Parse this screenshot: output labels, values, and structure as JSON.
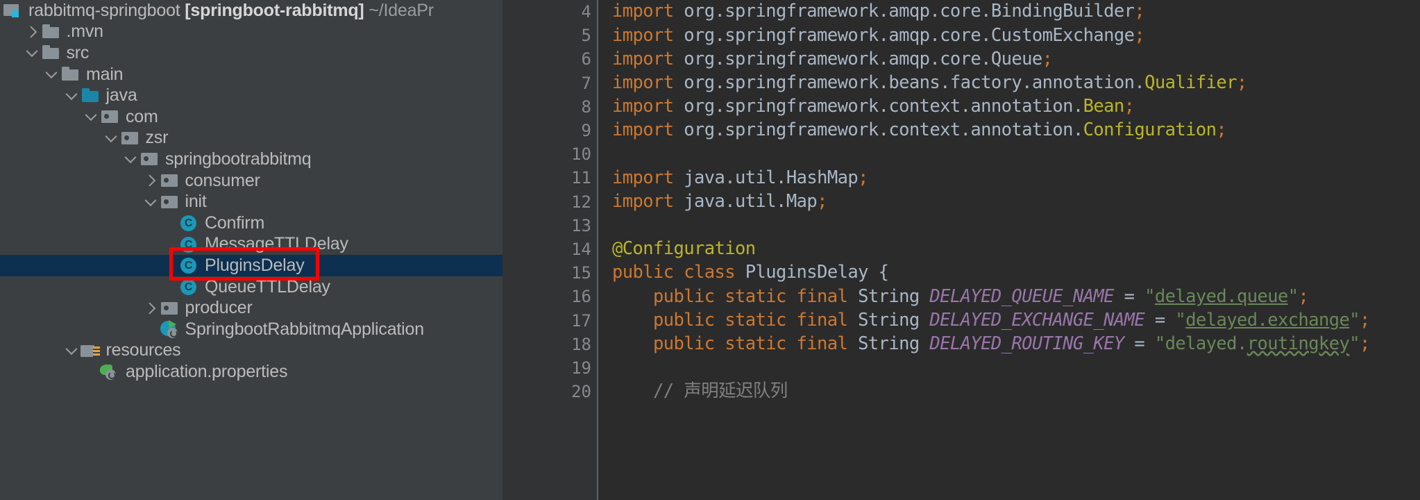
{
  "sidebar": {
    "project_root": {
      "name": "rabbitmq-springboot",
      "module": "[springboot-rabbitmq]",
      "path": "~/IdeaPr",
      "icon": "project-module-icon"
    },
    "items": [
      {
        "label": ".mvn",
        "icon": "folder-icon",
        "arrow": "right",
        "depth": 1,
        "selected": false
      },
      {
        "label": "src",
        "icon": "folder-icon",
        "arrow": "down",
        "depth": 1,
        "selected": false
      },
      {
        "label": "main",
        "icon": "folder-icon",
        "arrow": "down",
        "depth": 2,
        "selected": false
      },
      {
        "label": "java",
        "icon": "source-root-folder-icon",
        "arrow": "down",
        "depth": 3,
        "selected": false
      },
      {
        "label": "com",
        "icon": "package-folder-icon",
        "arrow": "down",
        "depth": 4,
        "selected": false
      },
      {
        "label": "zsr",
        "icon": "package-folder-icon",
        "arrow": "down",
        "depth": 5,
        "selected": false
      },
      {
        "label": "springbootrabbitmq",
        "icon": "package-folder-icon",
        "arrow": "down",
        "depth": 6,
        "selected": false
      },
      {
        "label": "consumer",
        "icon": "package-folder-icon",
        "arrow": "right",
        "depth": 7,
        "selected": false
      },
      {
        "label": "init",
        "icon": "package-folder-icon",
        "arrow": "down",
        "depth": 7,
        "selected": false
      },
      {
        "label": "Confirm",
        "icon": "java-class-icon",
        "arrow": "none",
        "depth": 8,
        "selected": false
      },
      {
        "label": "MessageTTLDelay",
        "icon": "java-class-icon",
        "arrow": "none",
        "depth": 8,
        "selected": false
      },
      {
        "label": "PluginsDelay",
        "icon": "java-class-icon",
        "arrow": "none",
        "depth": 8,
        "selected": true
      },
      {
        "label": "QueueTTLDelay",
        "icon": "java-class-icon",
        "arrow": "none",
        "depth": 8,
        "selected": false
      },
      {
        "label": "producer",
        "icon": "package-folder-icon",
        "arrow": "right",
        "depth": 7,
        "selected": false
      },
      {
        "label": "SpringbootRabbitmqApplication",
        "icon": "spring-boot-app-icon",
        "arrow": "none",
        "depth": 7,
        "selected": false
      },
      {
        "label": "resources",
        "icon": "resources-folder-icon",
        "arrow": "down",
        "depth": 3,
        "selected": false
      },
      {
        "label": "application.properties",
        "icon": "spring-properties-icon",
        "arrow": "none",
        "depth": 4,
        "selected": false
      }
    ],
    "annotation": {
      "color": "#ff0000",
      "target": "PluginsDelay"
    }
  },
  "editor": {
    "selection_color": "#0d3050",
    "background": "#2b2b2b",
    "gutter_background": "#313335",
    "lines": [
      {
        "no": "4",
        "gutter_icon": null,
        "fold": false,
        "tokens": [
          {
            "t": "import ",
            "c": "t-kw"
          },
          {
            "t": "org.springframework.amqp.core.",
            "c": "t-pkg"
          },
          {
            "t": "BindingBuilder",
            "c": "t-cls"
          },
          {
            "t": ";",
            "c": "t-semi"
          }
        ]
      },
      {
        "no": "5",
        "gutter_icon": null,
        "fold": false,
        "tokens": [
          {
            "t": "import ",
            "c": "t-kw"
          },
          {
            "t": "org.springframework.amqp.core.",
            "c": "t-pkg"
          },
          {
            "t": "CustomExchange",
            "c": "t-cls"
          },
          {
            "t": ";",
            "c": "t-semi"
          }
        ]
      },
      {
        "no": "6",
        "gutter_icon": null,
        "fold": false,
        "tokens": [
          {
            "t": "import ",
            "c": "t-kw"
          },
          {
            "t": "org.springframework.amqp.core.",
            "c": "t-pkg"
          },
          {
            "t": "Queue",
            "c": "t-cls"
          },
          {
            "t": ";",
            "c": "t-semi"
          }
        ]
      },
      {
        "no": "7",
        "gutter_icon": null,
        "fold": false,
        "tokens": [
          {
            "t": "import ",
            "c": "t-kw"
          },
          {
            "t": "org.springframework.beans.factory.annotation.",
            "c": "t-pkg"
          },
          {
            "t": "Qualifier",
            "c": "t-anno"
          },
          {
            "t": ";",
            "c": "t-semi"
          }
        ]
      },
      {
        "no": "8",
        "gutter_icon": null,
        "fold": false,
        "tokens": [
          {
            "t": "import ",
            "c": "t-kw"
          },
          {
            "t": "org.springframework.context.annotation.",
            "c": "t-pkg"
          },
          {
            "t": "Bean",
            "c": "t-anno"
          },
          {
            "t": ";",
            "c": "t-semi"
          }
        ]
      },
      {
        "no": "9",
        "gutter_icon": null,
        "fold": false,
        "tokens": [
          {
            "t": "import ",
            "c": "t-kw"
          },
          {
            "t": "org.springframework.context.annotation.",
            "c": "t-pkg"
          },
          {
            "t": "Configuration",
            "c": "t-anno"
          },
          {
            "t": ";",
            "c": "t-semi"
          }
        ]
      },
      {
        "no": "10",
        "gutter_icon": null,
        "fold": false,
        "tokens": []
      },
      {
        "no": "11",
        "gutter_icon": null,
        "fold": false,
        "tokens": [
          {
            "t": "import ",
            "c": "t-kw"
          },
          {
            "t": "java.util.",
            "c": "t-pkg"
          },
          {
            "t": "HashMap",
            "c": "t-cls"
          },
          {
            "t": ";",
            "c": "t-semi"
          }
        ]
      },
      {
        "no": "12",
        "gutter_icon": null,
        "fold": true,
        "tokens": [
          {
            "t": "import ",
            "c": "t-kw"
          },
          {
            "t": "java.util.",
            "c": "t-pkg"
          },
          {
            "t": "Map",
            "c": "t-cls"
          },
          {
            "t": ";",
            "c": "t-semi"
          }
        ]
      },
      {
        "no": "13",
        "gutter_icon": null,
        "fold": false,
        "tokens": []
      },
      {
        "no": "14",
        "gutter_icon": null,
        "fold": false,
        "tokens": [
          {
            "t": "@Configuration",
            "c": "t-anno"
          }
        ]
      },
      {
        "no": "15",
        "gutter_icon": "spring-bean-icon",
        "fold": false,
        "tokens": [
          {
            "t": "public ",
            "c": "t-kw"
          },
          {
            "t": "class ",
            "c": "t-kw"
          },
          {
            "t": "PluginsDelay",
            "c": "t-cls"
          },
          {
            "t": " {",
            "c": "t-punct"
          }
        ]
      },
      {
        "no": "16",
        "gutter_icon": null,
        "fold": false,
        "tokens": [
          {
            "t": "    ",
            "c": "t-plain"
          },
          {
            "t": "public static final ",
            "c": "t-kw"
          },
          {
            "t": "String ",
            "c": "t-cls"
          },
          {
            "t": "DELAYED_QUEUE_NAME",
            "c": "t-const"
          },
          {
            "t": " = ",
            "c": "t-punct"
          },
          {
            "t": "\"",
            "c": "t-str"
          },
          {
            "t": "delayed.queue",
            "c": "t-str-link"
          },
          {
            "t": "\"",
            "c": "t-str"
          },
          {
            "t": ";",
            "c": "t-semi"
          }
        ]
      },
      {
        "no": "17",
        "gutter_icon": null,
        "fold": false,
        "tokens": [
          {
            "t": "    ",
            "c": "t-plain"
          },
          {
            "t": "public static final ",
            "c": "t-kw"
          },
          {
            "t": "String ",
            "c": "t-cls"
          },
          {
            "t": "DELAYED_EXCHANGE_NAME",
            "c": "t-const"
          },
          {
            "t": " = ",
            "c": "t-punct"
          },
          {
            "t": "\"",
            "c": "t-str"
          },
          {
            "t": "delayed.exchange",
            "c": "t-str-link"
          },
          {
            "t": "\"",
            "c": "t-str"
          },
          {
            "t": ";",
            "c": "t-semi"
          }
        ]
      },
      {
        "no": "18",
        "gutter_icon": null,
        "fold": false,
        "tokens": [
          {
            "t": "    ",
            "c": "t-plain"
          },
          {
            "t": "public static final ",
            "c": "t-kw"
          },
          {
            "t": "String ",
            "c": "t-cls"
          },
          {
            "t": "DELAYED_ROUTING_KEY",
            "c": "t-const"
          },
          {
            "t": " = ",
            "c": "t-punct"
          },
          {
            "t": "\"",
            "c": "t-str"
          },
          {
            "t": "delayed.",
            "c": "t-str"
          },
          {
            "t": "routingkey",
            "c": "t-str-typo"
          },
          {
            "t": "\"",
            "c": "t-str"
          },
          {
            "t": ";",
            "c": "t-semi"
          }
        ]
      },
      {
        "no": "19",
        "gutter_icon": null,
        "fold": false,
        "tokens": []
      },
      {
        "no": "20",
        "gutter_icon": null,
        "fold": false,
        "tokens": [
          {
            "t": "    // 声明延迟队列",
            "c": "t-comment"
          }
        ]
      }
    ]
  }
}
